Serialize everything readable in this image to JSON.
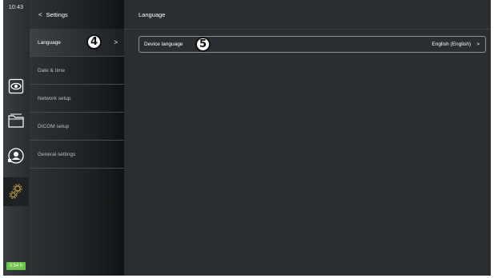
{
  "status": {
    "time": "10:43",
    "battery": "0:54 h"
  },
  "rail": {
    "buttons": [
      {
        "icon": "eye-icon"
      },
      {
        "icon": "folder-icon"
      },
      {
        "icon": "user-icon"
      },
      {
        "icon": "gears-icon",
        "active": true
      }
    ]
  },
  "settings_panel": {
    "back_label": "Settings",
    "items": [
      {
        "label": "Language",
        "selected": true
      },
      {
        "label": "Date & time"
      },
      {
        "label": "Network setup"
      },
      {
        "label": "DICOM setup"
      },
      {
        "label": "General settings"
      }
    ]
  },
  "main": {
    "title": "Language",
    "row": {
      "label": "Device language",
      "value": "English (English)"
    }
  },
  "callouts": {
    "a": "4",
    "b": "5"
  },
  "colors": {
    "background": "#2a2e32",
    "battery": "#6cc24a",
    "row_border": "#8b9196"
  }
}
